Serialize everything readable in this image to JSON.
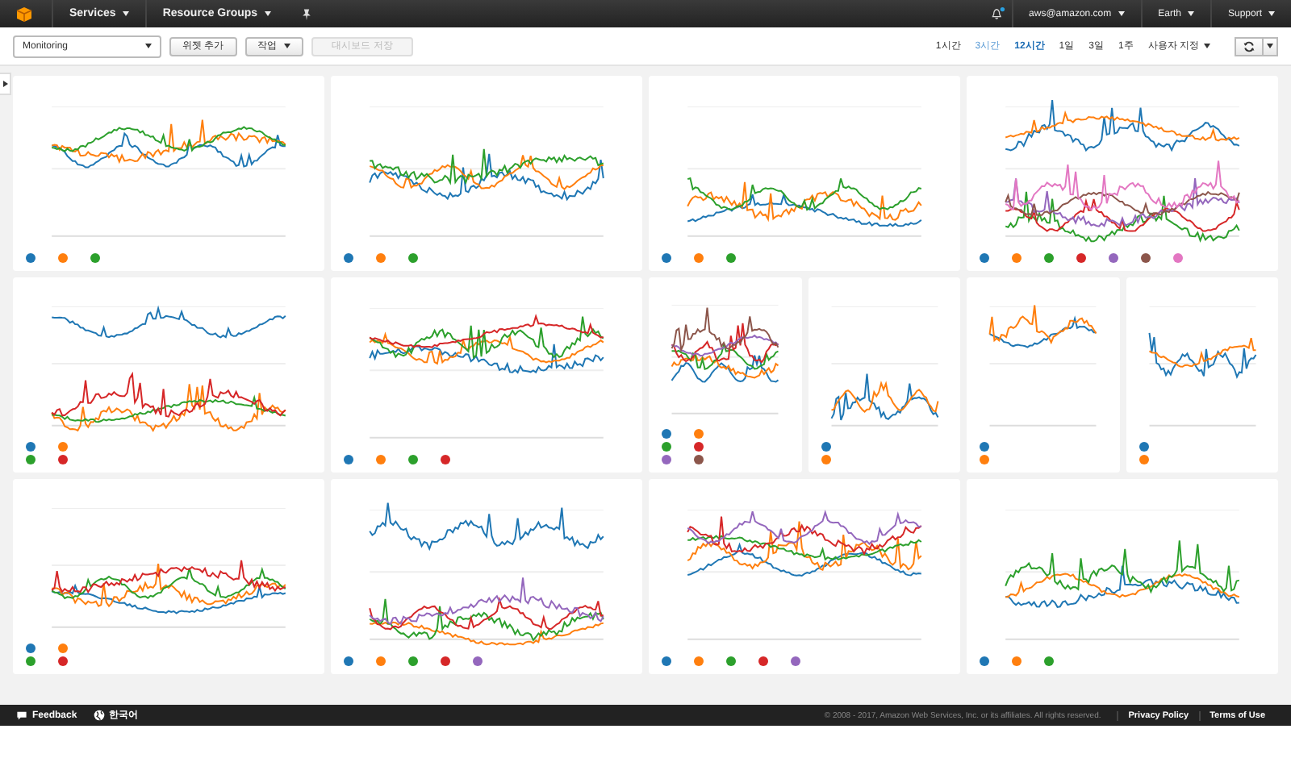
{
  "nav": {
    "menus": [
      {
        "label": "Services"
      },
      {
        "label": "Resource Groups"
      }
    ],
    "account": [
      {
        "label": "aws@amazon.com"
      },
      {
        "label": "Earth"
      },
      {
        "label": "Support"
      }
    ],
    "notification_unread": true
  },
  "toolbar": {
    "dashboard": {
      "value": "Monitoring"
    },
    "buttons": [
      {
        "label": "위젯 추가",
        "kind": "plain",
        "disabled": false
      },
      {
        "label": "작업",
        "kind": "menu",
        "disabled": false
      },
      {
        "label": "대시보드 저장",
        "kind": "plain",
        "disabled": true
      }
    ],
    "ranges": [
      {
        "label": "1시간",
        "selected": false,
        "hovered": false
      },
      {
        "label": "3시간",
        "selected": false,
        "hovered": true
      },
      {
        "label": "12시간",
        "selected": true,
        "hovered": false
      },
      {
        "label": "1일",
        "selected": false,
        "hovered": false
      },
      {
        "label": "3일",
        "selected": false,
        "hovered": false
      },
      {
        "label": "1주",
        "selected": false,
        "hovered": false
      },
      {
        "label": "사용자 지정",
        "selected": false,
        "hovered": false,
        "kind": "menu"
      }
    ]
  },
  "rows": [
    {
      "widgets": [
        {
          "kind": "large",
          "legend": [
            [
              {
                "color": "#1f77b4"
              },
              {
                "color": "#ff7f0e"
              },
              {
                "color": "#2ca02c"
              }
            ]
          ]
        },
        {
          "kind": "large",
          "legend": [
            [
              {
                "color": "#1f77b4"
              },
              {
                "color": "#ff7f0e"
              },
              {
                "color": "#2ca02c"
              }
            ]
          ]
        },
        {
          "kind": "large",
          "legend": [
            [
              {
                "color": "#1f77b4"
              },
              {
                "color": "#ff7f0e"
              },
              {
                "color": "#2ca02c"
              }
            ]
          ]
        },
        {
          "kind": "large",
          "legend": [
            [
              {
                "color": "#1f77b4"
              },
              {
                "color": "#ff7f0e"
              },
              {
                "color": "#2ca02c"
              },
              {
                "color": "#d62728"
              },
              {
                "color": "#9467bd"
              },
              {
                "color": "#8c564b"
              },
              {
                "color": "#e377c2"
              }
            ]
          ]
        }
      ]
    },
    {
      "widgets": [
        {
          "kind": "large",
          "legend": [
            [
              {
                "color": "#1f77b4"
              },
              {
                "color": "#ff7f0e"
              }
            ],
            [
              {
                "color": "#2ca02c"
              },
              {
                "color": "#d62728"
              }
            ]
          ]
        },
        {
          "kind": "large",
          "legend": [
            [
              {
                "color": "#1f77b4"
              },
              {
                "color": "#ff7f0e"
              },
              {
                "color": "#2ca02c"
              },
              {
                "color": "#d62728"
              }
            ]
          ]
        },
        {
          "kind": "small",
          "legend": [
            [
              {
                "color": "#1f77b4"
              },
              {
                "color": "#ff7f0e"
              }
            ],
            [
              {
                "color": "#2ca02c"
              },
              {
                "color": "#d62728"
              }
            ],
            [
              {
                "color": "#9467bd"
              },
              {
                "color": "#8c564b"
              }
            ]
          ]
        },
        {
          "kind": "small",
          "legend": [
            [
              {
                "color": "#1f77b4"
              }
            ],
            [
              {
                "color": "#ff7f0e"
              }
            ]
          ]
        },
        {
          "kind": "small",
          "legend": [
            [
              {
                "color": "#1f77b4"
              }
            ],
            [
              {
                "color": "#ff7f0e"
              }
            ]
          ]
        },
        {
          "kind": "small",
          "legend": [
            [
              {
                "color": "#1f77b4"
              }
            ],
            [
              {
                "color": "#ff7f0e"
              }
            ]
          ]
        }
      ]
    },
    {
      "widgets": [
        {
          "kind": "large",
          "legend": [
            [
              {
                "color": "#1f77b4"
              },
              {
                "color": "#ff7f0e"
              }
            ],
            [
              {
                "color": "#2ca02c"
              },
              {
                "color": "#d62728"
              }
            ]
          ]
        },
        {
          "kind": "large",
          "legend": [
            [
              {
                "color": "#1f77b4"
              },
              {
                "color": "#ff7f0e"
              },
              {
                "color": "#2ca02c"
              },
              {
                "color": "#d62728"
              },
              {
                "color": "#9467bd"
              }
            ]
          ]
        },
        {
          "kind": "large",
          "legend": [
            [
              {
                "color": "#1f77b4"
              },
              {
                "color": "#ff7f0e"
              },
              {
                "color": "#2ca02c"
              },
              {
                "color": "#d62728"
              },
              {
                "color": "#9467bd"
              }
            ]
          ]
        },
        {
          "kind": "large",
          "legend": [
            [
              {
                "color": "#1f77b4"
              },
              {
                "color": "#ff7f0e"
              },
              {
                "color": "#2ca02c"
              }
            ]
          ]
        }
      ]
    }
  ],
  "footer": {
    "feedback": "Feedback",
    "language": "한국어",
    "copyright": "© 2008 - 2017, Amazon Web Services, Inc. or its affiliates. All rights reserved.",
    "links": [
      {
        "label": "Privacy Policy"
      },
      {
        "label": "Terms of Use"
      }
    ]
  }
}
